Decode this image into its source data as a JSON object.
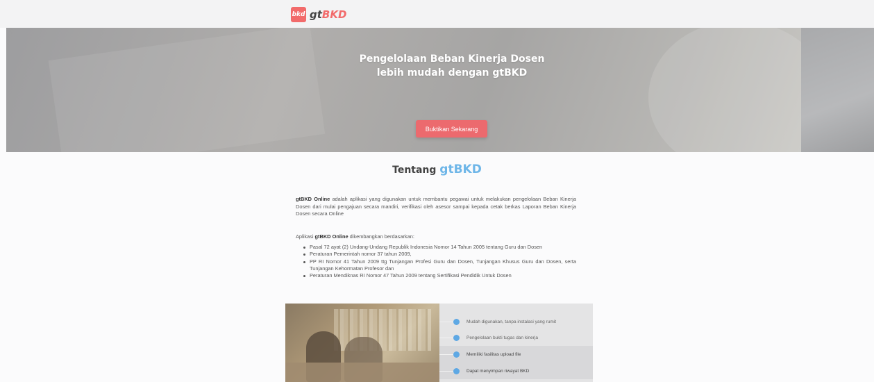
{
  "navbar": {
    "logo_badge": "bkd",
    "logo_prefix": "gt",
    "logo_suffix": "BKD"
  },
  "hero": {
    "title_line1": "Pengelolaan Beban Kinerja Dosen",
    "title_line2": "lebih mudah dengan gtBKD",
    "cta_label": "Buktikan Sekarang"
  },
  "about": {
    "title_prefix": "Tentang",
    "title_brand": "gtBKD",
    "intro_bold": "gtBKD Online",
    "intro_text": " adalah aplikasi yang digunakan untuk membantu pegawai untuk melakukan pengelolaan Beban Kinerja Dosen dari mulai pengajuan secara mandiri, verifikasi oleh asesor sampai kepada cetak berkas Laporan Beban Kinerja Dosen secara Online",
    "basis_prefix": "Aplikasi ",
    "basis_bold": "gtBKD Online",
    "basis_suffix": " dikembangkan berdasarkan:",
    "basis_items": [
      "Pasal 72 ayat (2) Undang-Undang Republik Indonesia Nomor 14 Tahun 2005 tentang Guru dan Dosen",
      "Peraturan Pemerintah nomor 37 tahun 2009,",
      "PP RI Nomor 41 Tahun 2009 ttg Tunjangan Profesi Guru dan Dosen, Tunjangan Khusus Guru dan Dosen, serta Tunjangan Kehormatan Profesor dan",
      "Peraturan Mendiknas RI Nomor 47 Tahun 2009 tentang Sertifikasi Pendidik Untuk Dosen"
    ]
  },
  "features": {
    "items": [
      "Mudah digunakan, tanpa instalasi yang rumit",
      "Pengelolaan bukti tugas dan kinerja",
      "Memiliki fasilitas upload file",
      "Dapat menyimpan riwayat BKD"
    ],
    "dot_color": "#5ea8e4"
  },
  "colors": {
    "brand": "#f26b6b",
    "cta": "#ec6a6e",
    "accent_blue": "#6eb6e8"
  }
}
